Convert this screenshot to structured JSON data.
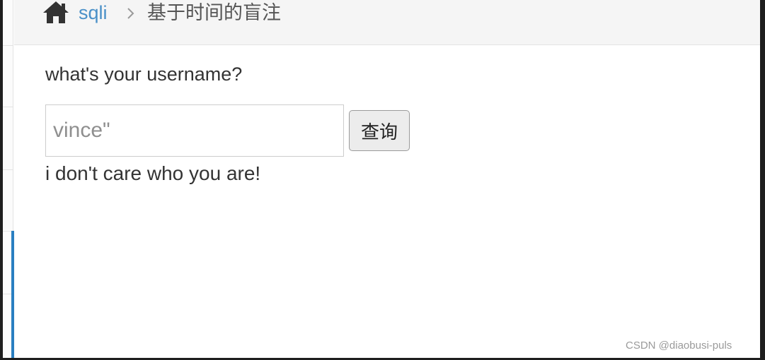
{
  "breadcrumb": {
    "home_icon": "home-icon",
    "link": "sqli",
    "separator_icon": "chevron-right-icon",
    "current": "基于时间的盲注"
  },
  "form": {
    "prompt": "what's your username?",
    "input": {
      "value": "",
      "placeholder": "vince\""
    },
    "submit_label": "查询"
  },
  "result": {
    "message": "i don't care who you are!"
  },
  "watermark": "CSDN @diaobusi-puls",
  "colors": {
    "accent": "#2a7fc1",
    "link": "#4a90c8",
    "header_bg": "#f5f5f5"
  }
}
